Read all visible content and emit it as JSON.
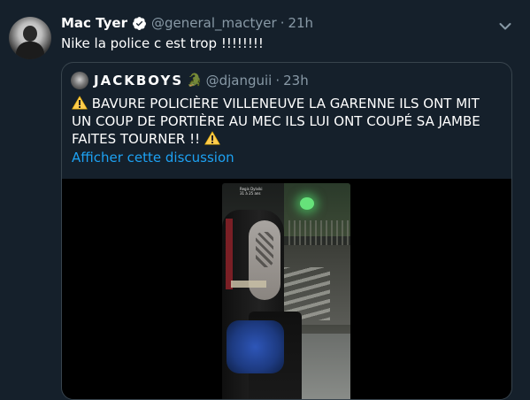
{
  "tweet": {
    "author_name": "Mac Tyer",
    "handle": "@general_mactyer",
    "separator": "·",
    "time": "21h",
    "text": "Nike la police c est trop !!!!!!!!"
  },
  "quoted_tweet": {
    "author_name": "JACKBOYS",
    "author_emoji": "🐊",
    "handle": "@djanguii",
    "separator": "·",
    "time": "23h",
    "text_part1": " BAVURE POLICIÈRE  VILLENEUVE LA GARENNE ILS ONT MIT UN COUP DE PORTIÈRE AU MEC ILS LUI ONT COUPÉ SA JAMBE FAITES TOURNER !! ",
    "link_text": "Afficher cette discussion",
    "video_overlay_line1": "Regis Dylviki",
    "video_overlay_line2": "31 à 25 ans"
  },
  "colors": {
    "background": "#15202b",
    "secondary_text": "#8899a6",
    "link": "#1da1f2",
    "border": "#38444d",
    "verified": "#ffffff",
    "warning": "#ffcc4d"
  },
  "icons": {
    "verified": "verified-badge-icon",
    "chevron": "chevron-down-icon",
    "warning": "warning-sign-icon"
  }
}
